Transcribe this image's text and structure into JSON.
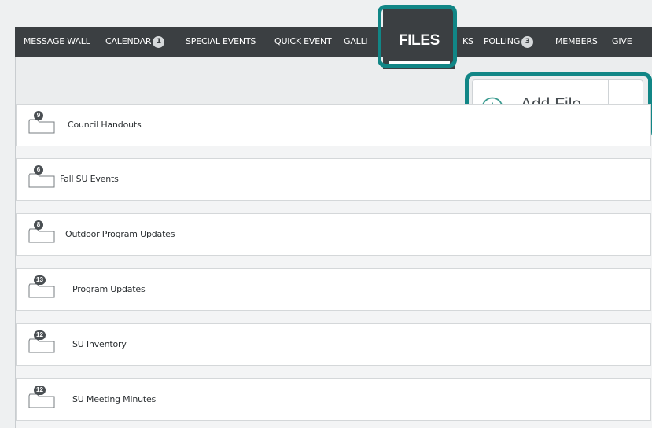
{
  "nav": {
    "items": [
      {
        "label": "MESSAGE WALL",
        "badge": null
      },
      {
        "label": "CALENDAR",
        "badge": "1"
      },
      {
        "label": "SPECIAL EVENTS",
        "badge": null
      },
      {
        "label": "QUICK EVENT",
        "badge": null
      },
      {
        "label": "GALLI",
        "badge": null
      },
      {
        "label": "KS",
        "badge": null
      },
      {
        "label": "POLLING",
        "badge": "3"
      },
      {
        "label": "MEMBERS",
        "badge": null
      },
      {
        "label": "GIVE",
        "badge": null
      }
    ],
    "active_tab": "FILES"
  },
  "toolbar": {
    "add_file_label": "Add File",
    "add_icon": "plus-circle-icon",
    "dropdown_icon": "caret-down-icon"
  },
  "folders": [
    {
      "name": "Council Handouts",
      "count": "9"
    },
    {
      "name": "Fall SU Events",
      "count": "6"
    },
    {
      "name": "Outdoor Program Updates",
      "count": "8"
    },
    {
      "name": "Program Updates",
      "count": "13"
    },
    {
      "name": "SU Inventory",
      "count": "12"
    },
    {
      "name": "SU Meeting Minutes",
      "count": "12"
    }
  ],
  "colors": {
    "nav_bg": "#3b3f42",
    "highlight": "#118686",
    "panel_bg": "#f3f4f5"
  }
}
